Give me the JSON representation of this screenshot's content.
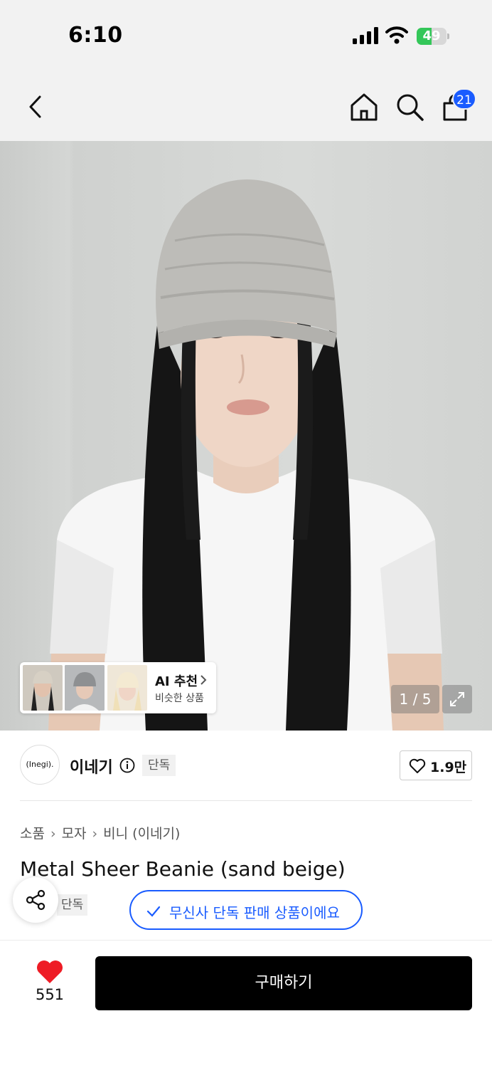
{
  "status_bar": {
    "time": "6:10",
    "battery": "49",
    "battery_level": 0.49
  },
  "nav": {
    "cart_count": "21"
  },
  "hero": {
    "ai_title": "AI 추천",
    "ai_subtitle": "비슷한 상품",
    "pager": "1 / 5"
  },
  "brand": {
    "logo_text": "(Inegi).",
    "name": "이네기",
    "exclusive_tag": "단독",
    "like_count": "1.9만"
  },
  "breadcrumb": [
    "소품",
    "모자",
    "비니 (이네기)"
  ],
  "product": {
    "title": "Metal Sheer Beanie (sand beige)",
    "tag": "단독",
    "exclusive_notice": "무신사 단독 판매 상품이에요"
  },
  "bottom_bar": {
    "like_count": "551",
    "buy_label": "구매하기"
  },
  "colors": {
    "accent": "#1a5cff",
    "heart": "#ee1c25",
    "battery": "#34c759"
  }
}
